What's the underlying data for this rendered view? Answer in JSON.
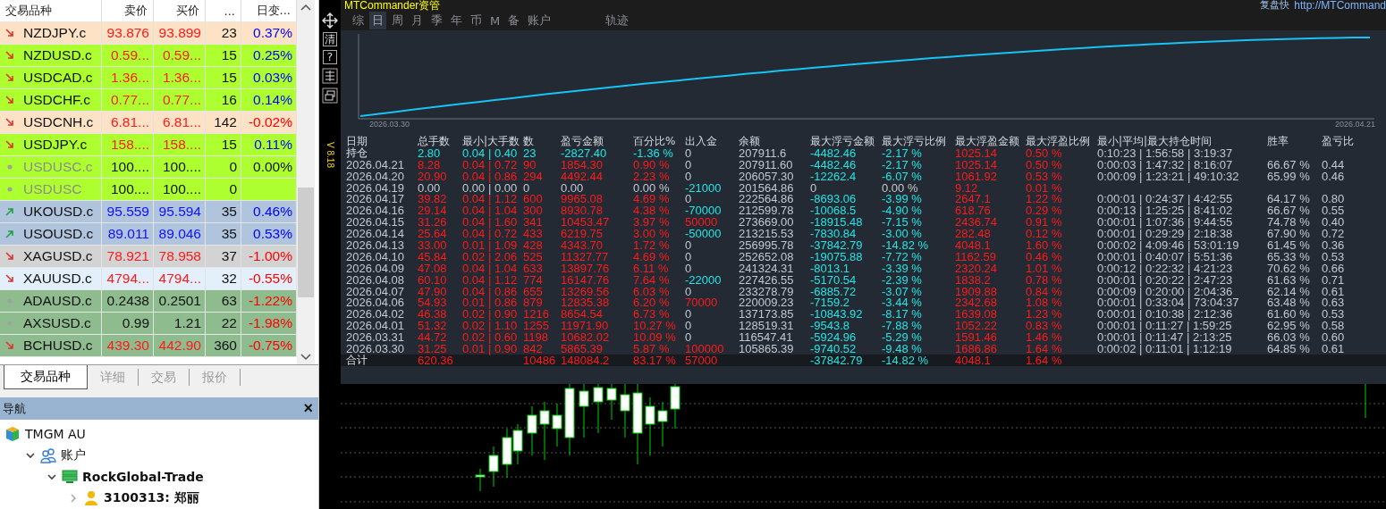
{
  "market_watch": {
    "columns": [
      "交易品种",
      "卖价",
      "买价",
      "...",
      "日变..."
    ],
    "rows": [
      {
        "symbol": "NZDJPY.c",
        "bid": "93.876",
        "ask": "93.899",
        "spread": "23",
        "change": {
          "text": "0.37%",
          "color": "#0000ff"
        },
        "kind": "down",
        "color": "#fde2c6",
        "disabled": false
      },
      {
        "symbol": "NZDUSD.c",
        "bid": "0.59...",
        "ask": "0.59...",
        "spread": "15",
        "change": {
          "text": "0.25%",
          "color": "#0000ff"
        },
        "kind": "down",
        "color": "#adff2f",
        "disabled": false
      },
      {
        "symbol": "USDCAD.c",
        "bid": "1.36...",
        "ask": "1.36...",
        "spread": "15",
        "change": {
          "text": "0.03%",
          "color": "#0000ff"
        },
        "kind": "down",
        "color": "#adff2f",
        "disabled": false
      },
      {
        "symbol": "USDCHF.c",
        "bid": "0.77...",
        "ask": "0.77...",
        "spread": "16",
        "change": {
          "text": "0.14%",
          "color": "#0000ff"
        },
        "kind": "down",
        "color": "#adff2f",
        "disabled": false
      },
      {
        "symbol": "USDCNH.c",
        "bid": "6.81...",
        "ask": "6.81...",
        "spread": "142",
        "change": {
          "text": "-0.02%",
          "color": "#ff0000"
        },
        "kind": "down",
        "color": "#fde2c6",
        "disabled": false
      },
      {
        "symbol": "USDJPY.c",
        "bid": "158....",
        "ask": "158....",
        "spread": "15",
        "change": {
          "text": "0.11%",
          "color": "#0000ff"
        },
        "kind": "down",
        "color": "#adff2f",
        "disabled": false
      },
      {
        "symbol": "USDUSC.c",
        "bid": "100....",
        "ask": "100....",
        "spread": "0",
        "change": {
          "text": "0.00%",
          "color": "#111111"
        },
        "kind": "flat",
        "color": "#adff2f",
        "disabled": true
      },
      {
        "symbol": "USDUSC",
        "bid": "100....",
        "ask": "100....",
        "spread": "0",
        "kind": "flat",
        "color": "#adff2f",
        "disabled": true
      },
      {
        "symbol": "UKOUSD.c",
        "bid": "95.559",
        "ask": "95.594",
        "spread": "35",
        "change": {
          "text": "0.46%",
          "color": "#0000ff"
        },
        "kind": "up",
        "color": "#b0c4de",
        "disabled": false
      },
      {
        "symbol": "USOUSD.c",
        "bid": "89.011",
        "ask": "89.046",
        "spread": "35",
        "change": {
          "text": "0.53%",
          "color": "#0000ff"
        },
        "kind": "up",
        "color": "#b0c4de",
        "disabled": false
      },
      {
        "symbol": "XAGUSD.c",
        "bid": "78.921",
        "ask": "78.958",
        "spread": "37",
        "change": {
          "text": "-1.00%",
          "color": "#ff0000"
        },
        "kind": "down",
        "color": "#d3d3d3",
        "disabled": false
      },
      {
        "symbol": "XAUUSD.c",
        "bid": "4794...",
        "ask": "4794...",
        "spread": "32",
        "change": {
          "text": "-0.55%",
          "color": "#ff0000"
        },
        "kind": "down",
        "color": "#e3f0fb",
        "disabled": false
      },
      {
        "symbol": "ADAUSD.c",
        "bid": "0.2438",
        "ask": "0.2501",
        "spread": "63",
        "change": {
          "text": "-1.22%",
          "color": "#ff0000"
        },
        "kind": "flat",
        "color": "#8fbc8f",
        "disabled": false
      },
      {
        "symbol": "AXSUSD.c",
        "bid": "0.99",
        "ask": "1.21",
        "spread": "22",
        "change": {
          "text": "-1.98%",
          "color": "#ff0000"
        },
        "kind": "flat",
        "color": "#8fbc8f",
        "disabled": false
      },
      {
        "symbol": "BCHUSD.c",
        "bid": "439.30",
        "ask": "442.90",
        "spread": "360",
        "change": {
          "text": "-0.75%",
          "color": "#ff0000"
        },
        "kind": "down",
        "color": "#8fbc8f",
        "disabled": false
      }
    ],
    "tabs": [
      {
        "label": "交易品种",
        "selected": true
      },
      {
        "label": "详细",
        "selected": false
      },
      {
        "label": "交易",
        "selected": false
      },
      {
        "label": "报价",
        "selected": false
      }
    ]
  },
  "navigator": {
    "title": "导航",
    "close": "×",
    "tree": [
      {
        "label": "TMGM AU",
        "kind": "broker",
        "bold": false,
        "children": [
          {
            "label": "账户",
            "kind": "users",
            "bold": false,
            "expanded": true,
            "children": [
              {
                "label": "RockGlobal-Trade",
                "kind": "server",
                "bold": true,
                "expanded": true,
                "children": [
                  {
                    "label": "3100313: 郑丽",
                    "kind": "user",
                    "bold": true,
                    "expanded": false
                  }
                ]
              }
            ]
          }
        ]
      }
    ]
  },
  "commander": {
    "title": "MTCommander资管",
    "right_label": "复盘快",
    "right_link": "http://MTCommand",
    "tools": [
      {
        "kind": "move"
      },
      {
        "kind": "text",
        "label": "清"
      },
      {
        "kind": "text",
        "label": "?"
      },
      {
        "kind": "grid"
      },
      {
        "kind": "restore"
      }
    ],
    "version": "V 8.18",
    "tabs": [
      {
        "label": "综",
        "selected": false
      },
      {
        "label": "日",
        "selected": true
      },
      {
        "label": "周",
        "selected": false
      },
      {
        "label": "月",
        "selected": false
      },
      {
        "label": "季",
        "selected": false
      },
      {
        "label": "年",
        "selected": false
      },
      {
        "label": "币",
        "selected": false
      },
      {
        "label": "M",
        "selected": false
      },
      {
        "label": "备",
        "selected": false
      },
      {
        "label": "账户",
        "selected": false
      },
      {
        "label": "轨迹",
        "selected": false
      }
    ],
    "chart": {
      "start_label": "2026.03.30",
      "end_label": "2026.04.21"
    },
    "table": {
      "columns": [
        "日期",
        "总手数",
        "最小|大手数",
        "数",
        "盈亏金额",
        "百分比%",
        "出入金",
        "余额",
        "最大浮亏金额",
        "最大浮亏比例",
        "最大浮盈金额",
        "最大浮盈比例",
        "最小|平均|最大持仓时间",
        "胜率",
        "盈亏比"
      ],
      "rows": [
        {
          "kind": "open",
          "color": "#22e5e5",
          "d": "持仓",
          "lots": "2.80",
          "mm": "0.04 | 0.40",
          "n": "23",
          "pnl": "-2827.40",
          "pct": "-1.36 %",
          "flow": {
            "text": "0",
            "color": "#c3c8d0"
          },
          "bal": "207911.6",
          "drawdown": {
            "amount": "-4482.46",
            "percent": "-2.17 %",
            "color": "#22e5e5"
          },
          "fp": "1025.14",
          "fpp": "0.50 %",
          "hold": "0:10:23 | 1:56:58 | 3:19:37"
        },
        {
          "kind": "day",
          "color": "#ff1a1a",
          "d": "2026.04.21",
          "lots": "8.28",
          "mm": "0.04 | 0.72",
          "n": "90",
          "pnl": "1854.30",
          "pct": "0.90 %",
          "flow": {
            "text": "0",
            "color": "#c3c8d0"
          },
          "bal": "207911.60",
          "drawdown": {
            "amount": "-4482.46",
            "percent": "-2.17 %",
            "color": "#22e5e5"
          },
          "fp": "1025.14",
          "fpp": "0.50 %",
          "hold": "0:00:03 | 1:47:32 | 8:16:07",
          "win": "66.67 %",
          "pl": "0.44"
        },
        {
          "kind": "day",
          "color": "#ff1a1a",
          "d": "2026.04.20",
          "lots": "20.90",
          "mm": "0.04 | 0.86",
          "n": "294",
          "pnl": "4492.44",
          "pct": "2.23 %",
          "flow": {
            "text": "0",
            "color": "#c3c8d0"
          },
          "bal": "206057.30",
          "drawdown": {
            "amount": "-12262.4",
            "percent": "-6.07 %",
            "color": "#22e5e5"
          },
          "fp": "1061.92",
          "fpp": "0.53 %",
          "hold": "0:00:09 | 1:23:21 | 49:10:32",
          "win": "65.99 %",
          "pl": "0.46"
        },
        {
          "kind": "day",
          "color": "#c3c8d0",
          "d": "2026.04.19",
          "lots": "0.00",
          "mm": "0.00 | 0.00",
          "n": "0",
          "pnl": "0.00",
          "pct": "0.00 %",
          "flow": {
            "text": "-21000",
            "color": "#22e5e5"
          },
          "bal": "201564.86",
          "drawdown": {
            "amount": "0",
            "percent": "0.00 %",
            "color": "#c3c8d0"
          },
          "fp": "9.12",
          "fpp": "0.01 %"
        },
        {
          "kind": "day",
          "color": "#ff1a1a",
          "d": "2026.04.17",
          "lots": "39.82",
          "mm": "0.04 | 1.12",
          "n": "600",
          "pnl": "9965.08",
          "pct": "4.69 %",
          "flow": {
            "text": "0",
            "color": "#c3c8d0"
          },
          "bal": "222564.86",
          "drawdown": {
            "amount": "-8693.06",
            "percent": "-3.99 %",
            "color": "#22e5e5"
          },
          "fp": "2647.1",
          "fpp": "1.22 %",
          "hold": "0:00:01 | 0:24:37 | 4:42:55",
          "win": "64.17 %",
          "pl": "0.80"
        },
        {
          "kind": "day",
          "color": "#ff1a1a",
          "d": "2026.04.16",
          "lots": "29.14",
          "mm": "0.04 | 1.04",
          "n": "300",
          "pnl": "8930.78",
          "pct": "4.38 %",
          "flow": {
            "text": "-70000",
            "color": "#22e5e5"
          },
          "bal": "212599.78",
          "drawdown": {
            "amount": "-10068.5",
            "percent": "-4.90 %",
            "color": "#22e5e5"
          },
          "fp": "618.76",
          "fpp": "0.29 %",
          "hold": "0:00:13 | 1:25:25 | 8:41:02",
          "win": "66.67 %",
          "pl": "0.55"
        },
        {
          "kind": "day",
          "color": "#ff1a1a",
          "d": "2026.04.15",
          "lots": "31.26",
          "mm": "0.04 | 1.60",
          "n": "341",
          "pnl": "10453.47",
          "pct": "3.97 %",
          "flow": {
            "text": "50000",
            "color": "#ff1a1a"
          },
          "bal": "273669.00",
          "drawdown": {
            "amount": "-18915.48",
            "percent": "-7.15 %",
            "color": "#22e5e5"
          },
          "fp": "2436.74",
          "fpp": "0.91 %",
          "hold": "0:00:01 | 1:07:36 | 9:44:55",
          "win": "74.78 %",
          "pl": "0.40"
        },
        {
          "kind": "day",
          "color": "#ff1a1a",
          "d": "2026.04.14",
          "lots": "25.64",
          "mm": "0.04 | 0.72",
          "n": "433",
          "pnl": "6219.75",
          "pct": "3.00 %",
          "flow": {
            "text": "-50000",
            "color": "#22e5e5"
          },
          "bal": "213215.53",
          "drawdown": {
            "amount": "-7830.84",
            "percent": "-3.00 %",
            "color": "#22e5e5"
          },
          "fp": "282.48",
          "fpp": "0.12 %",
          "hold": "0:00:01 | 0:29:29 | 2:18:38",
          "win": "67.90 %",
          "pl": "0.72"
        },
        {
          "kind": "day",
          "color": "#ff1a1a",
          "d": "2026.04.13",
          "lots": "33.00",
          "mm": "0.01 | 1.09",
          "n": "428",
          "pnl": "4343.70",
          "pct": "1.72 %",
          "flow": {
            "text": "0",
            "color": "#c3c8d0"
          },
          "bal": "256995.78",
          "drawdown": {
            "amount": "-37842.79",
            "percent": "-14.82 %",
            "color": "#22e5e5"
          },
          "fp": "4048.1",
          "fpp": "1.60 %",
          "hold": "0:00:02 | 4:09:46 | 53:01:19",
          "win": "61.45 %",
          "pl": "0.36"
        },
        {
          "kind": "day",
          "color": "#ff1a1a",
          "d": "2026.04.10",
          "lots": "45.84",
          "mm": "0.02 | 2.06",
          "n": "525",
          "pnl": "11327.77",
          "pct": "4.69 %",
          "flow": {
            "text": "0",
            "color": "#c3c8d0"
          },
          "bal": "252652.08",
          "drawdown": {
            "amount": "-19075.88",
            "percent": "-7.72 %",
            "color": "#22e5e5"
          },
          "fp": "1162.59",
          "fpp": "0.46 %",
          "hold": "0:00:01 | 0:40:07 | 5:51:36",
          "win": "65.33 %",
          "pl": "0.53"
        },
        {
          "kind": "day",
          "color": "#ff1a1a",
          "d": "2026.04.09",
          "lots": "47.08",
          "mm": "0.04 | 1.04",
          "n": "633",
          "pnl": "13897.76",
          "pct": "6.11 %",
          "flow": {
            "text": "0",
            "color": "#c3c8d0"
          },
          "bal": "241324.31",
          "drawdown": {
            "amount": "-8013.1",
            "percent": "-3.39 %",
            "color": "#22e5e5"
          },
          "fp": "2320.24",
          "fpp": "1.01 %",
          "hold": "0:00:12 | 0:22:32 | 4:21:23",
          "win": "70.62 %",
          "pl": "0.66"
        },
        {
          "kind": "day",
          "color": "#ff1a1a",
          "d": "2026.04.08",
          "lots": "60.10",
          "mm": "0.04 | 1.12",
          "n": "774",
          "pnl": "16147.76",
          "pct": "7.64 %",
          "flow": {
            "text": "-22000",
            "color": "#22e5e5"
          },
          "bal": "227426.55",
          "drawdown": {
            "amount": "-5170.54",
            "percent": "-2.39 %",
            "color": "#22e5e5"
          },
          "fp": "1838.2",
          "fpp": "0.78 %",
          "hold": "0:00:01 | 0:20:22 | 2:47:23",
          "win": "61.63 %",
          "pl": "0.71"
        },
        {
          "kind": "day",
          "color": "#ff1a1a",
          "d": "2026.04.07",
          "lots": "47.90",
          "mm": "0.04 | 0.86",
          "n": "655",
          "pnl": "13269.56",
          "pct": "6.03 %",
          "flow": {
            "text": "0",
            "color": "#c3c8d0"
          },
          "bal": "233278.79",
          "drawdown": {
            "amount": "-6885.72",
            "percent": "-3.07 %",
            "color": "#22e5e5"
          },
          "fp": "1909.88",
          "fpp": "0.84 %",
          "hold": "0:00:09 | 0:20:00 | 2:04:36",
          "win": "62.14 %",
          "pl": "0.61"
        },
        {
          "kind": "day",
          "color": "#ff1a1a",
          "d": "2026.04.06",
          "lots": "54.93",
          "mm": "0.01 | 0.86",
          "n": "879",
          "pnl": "12835.38",
          "pct": "6.20 %",
          "flow": {
            "text": "70000",
            "color": "#ff1a1a"
          },
          "bal": "220009.23",
          "drawdown": {
            "amount": "-7159.2",
            "percent": "-3.44 %",
            "color": "#22e5e5"
          },
          "fp": "2342.68",
          "fpp": "1.08 %",
          "hold": "0:00:01 | 0:33:04 | 73:04:37",
          "win": "63.48 %",
          "pl": "0.63"
        },
        {
          "kind": "day",
          "color": "#ff1a1a",
          "d": "2026.04.02",
          "lots": "46.38",
          "mm": "0.02 | 0.90",
          "n": "1216",
          "pnl": "8654.54",
          "pct": "6.73 %",
          "flow": {
            "text": "0",
            "color": "#c3c8d0"
          },
          "bal": "137173.85",
          "drawdown": {
            "amount": "-10843.92",
            "percent": "-8.17 %",
            "color": "#22e5e5"
          },
          "fp": "1639.08",
          "fpp": "1.23 %",
          "hold": "0:00:01 | 0:10:38 | 2:12:36",
          "win": "61.60 %",
          "pl": "0.53"
        },
        {
          "kind": "day",
          "color": "#ff1a1a",
          "d": "2026.04.01",
          "lots": "51.32",
          "mm": "0.02 | 1.10",
          "n": "1255",
          "pnl": "11971.90",
          "pct": "10.27 %",
          "flow": {
            "text": "0",
            "color": "#c3c8d0"
          },
          "bal": "128519.31",
          "drawdown": {
            "amount": "-9543.8",
            "percent": "-7.88 %",
            "color": "#22e5e5"
          },
          "fp": "1052.22",
          "fpp": "0.83 %",
          "hold": "0:00:01 | 0:11:27 | 1:59:25",
          "win": "62.95 %",
          "pl": "0.58"
        },
        {
          "kind": "day",
          "color": "#ff1a1a",
          "d": "2026.03.31",
          "lots": "44.72",
          "mm": "0.02 | 0.60",
          "n": "1198",
          "pnl": "10682.02",
          "pct": "10.09 %",
          "flow": {
            "text": "0",
            "color": "#c3c8d0"
          },
          "bal": "116547.41",
          "drawdown": {
            "amount": "-5924.96",
            "percent": "-5.29 %",
            "color": "#22e5e5"
          },
          "fp": "1591.46",
          "fpp": "1.46 %",
          "hold": "0:00:01 | 0:11:47 | 2:13:25",
          "win": "66.03 %",
          "pl": "0.60"
        },
        {
          "kind": "day",
          "color": "#ff1a1a",
          "d": "2026.03.30",
          "lots": "31.25",
          "mm": "0.01 | 0.90",
          "n": "842",
          "pnl": "5865.39",
          "pct": "5.87 %",
          "flow": {
            "text": "100000",
            "color": "#ff1a1a"
          },
          "bal": "105865.39",
          "drawdown": {
            "amount": "-9740.52",
            "percent": "-9.48 %",
            "color": "#22e5e5"
          },
          "fp": "1686.86",
          "fpp": "1.64 %",
          "hold": "0:00:02 | 0:11:01 | 1:12:19",
          "win": "64.85 %",
          "pl": "0.61"
        },
        {
          "kind": "total",
          "color": "#ff1a1a",
          "d": "合计",
          "lots": "620.36",
          "n": "10486",
          "pnl": "148084.2",
          "pct": "83.17 %",
          "flow": {
            "text": "57000",
            "color": "#ff1a1a"
          },
          "drawdown": {
            "amount": "-37842.79",
            "percent": "-14.82 %",
            "color": "#22e5e5"
          },
          "fp": "4048.1",
          "fpp": "1.64 %"
        }
      ]
    }
  }
}
